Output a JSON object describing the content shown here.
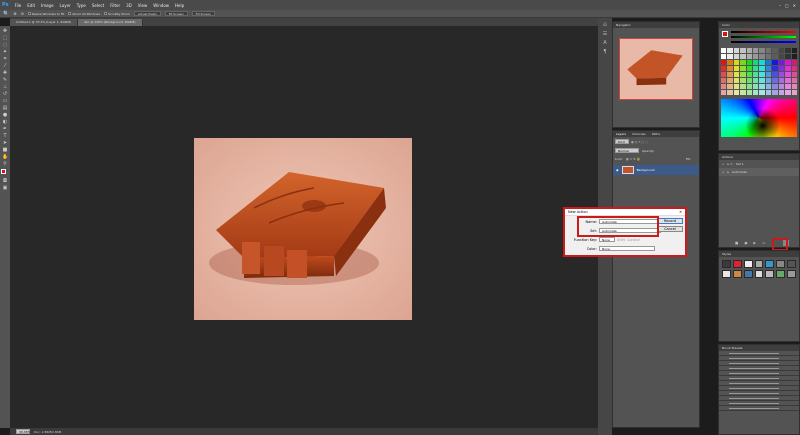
{
  "app": {
    "logo": "Ps"
  },
  "menu": [
    "File",
    "Edit",
    "Image",
    "Layer",
    "Type",
    "Select",
    "Filter",
    "3D",
    "View",
    "Window",
    "Help"
  ],
  "options_bar": {
    "resize_windows": "Resize Windows to Fit",
    "zoom_all": "Zoom All Windows",
    "scrubby_zoom": "Scrubby Zoom",
    "actual_pixels": "Actual Pixels",
    "fit_screen": "Fit Screen",
    "fill_screen": "Fill Screen"
  },
  "doc_tabs": [
    "Untitled-1 @ 33.3% (Layer 1, RGB/8)",
    "abc @ 100% (Background, RGB/8)"
  ],
  "status": {
    "zoom": "33.33%",
    "doc_size": "Doc: 2.86M/2.86M"
  },
  "navigator": {
    "title": "Navigator"
  },
  "layers_panel": {
    "tabs": [
      "Layers",
      "Channels",
      "Paths"
    ],
    "kind": "Kind",
    "blend": "Normal",
    "opacity": "Opacity:",
    "lock": "Lock:",
    "fill": "Fill:",
    "layer_name": "Background"
  },
  "color_panel": {
    "title": "Color"
  },
  "actions_panel": {
    "title": "Actions",
    "set_name": "Set 1",
    "action_name": "Automate"
  },
  "styles_panel": {
    "title": "Styles"
  },
  "brush_panel": {
    "title": "Brush Presets"
  },
  "dialog": {
    "title": "New Action",
    "close": "✕",
    "name_label": "Name:",
    "name_value": "Automate",
    "set_label": "Set:",
    "set_value": "Automate",
    "fkey_label": "Function Key:",
    "fkey_value": "None",
    "shift": "Shift",
    "control": "Control",
    "color_label": "Color:",
    "color_value": "None",
    "record": "Record",
    "cancel": "Cancel"
  },
  "colors": {
    "accent": "#cc1a1a",
    "canvas_bg": "#e9b9a8",
    "wood": "#b5451b"
  }
}
